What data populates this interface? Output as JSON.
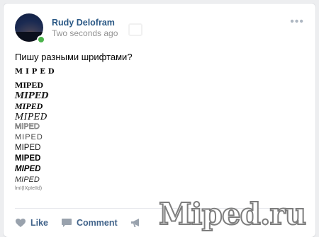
{
  "post": {
    "author": "Rudy Delofram",
    "time": "Two seconds ago",
    "text": "Пишу разными шрифтами?",
    "styled_lines": [
      "MIPED",
      "MIPED",
      "MIPED",
      "MIPED",
      "MIPED",
      "MIPED",
      "MIPED",
      "MIPED",
      "MIPED",
      "MIPED",
      "MIPED",
      "lmI(IXpIeIId)"
    ],
    "more_icon": "more-dots-icon"
  },
  "actions": {
    "like_label": "Like",
    "comment_label": "Comment",
    "share_icon": "megaphone-icon"
  },
  "watermark": "Miped.ru",
  "colors": {
    "background": "#edeef0",
    "link": "#2a5885",
    "action": "#42648b",
    "online": "#4bb34b"
  }
}
